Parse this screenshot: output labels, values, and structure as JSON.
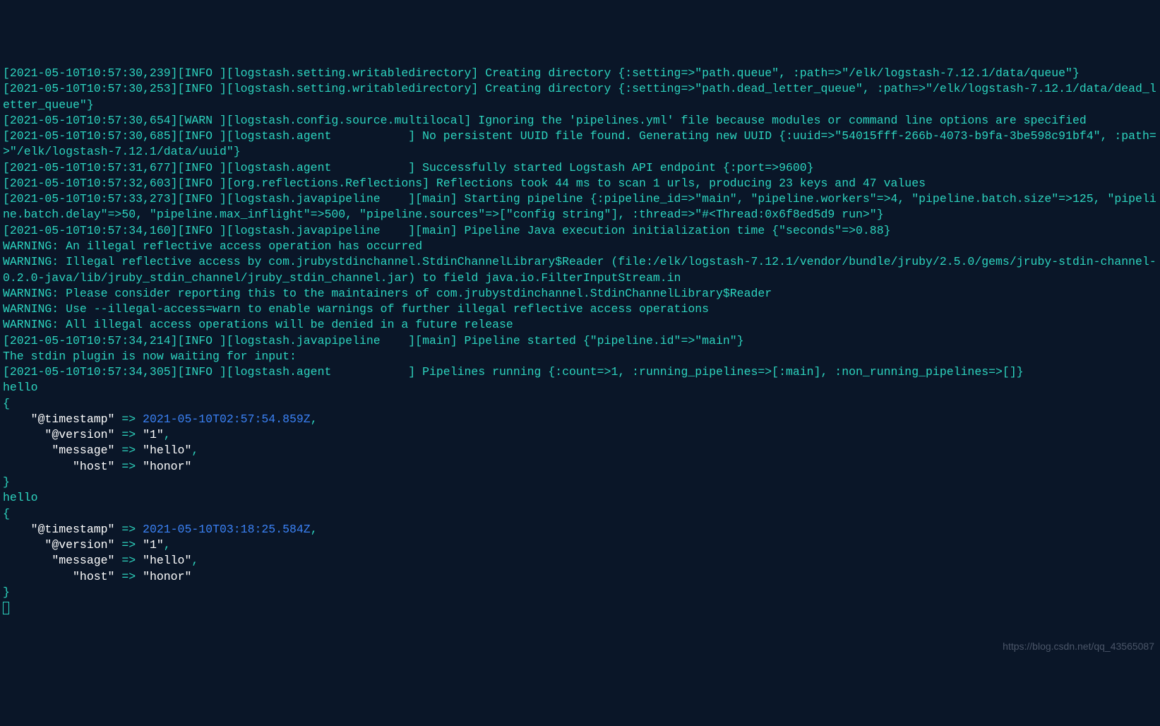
{
  "lines": [
    "[2021-05-10T10:57:30,239][INFO ][logstash.setting.writabledirectory] Creating directory {:setting=>\"path.queue\", :path=>\"/elk/logstash-7.12.1/data/queue\"}",
    "[2021-05-10T10:57:30,253][INFO ][logstash.setting.writabledirectory] Creating directory {:setting=>\"path.dead_letter_queue\", :path=>\"/elk/logstash-7.12.1/data/dead_letter_queue\"}",
    "[2021-05-10T10:57:30,654][WARN ][logstash.config.source.multilocal] Ignoring the 'pipelines.yml' file because modules or command line options are specified",
    "[2021-05-10T10:57:30,685][INFO ][logstash.agent           ] No persistent UUID file found. Generating new UUID {:uuid=>\"54015fff-266b-4073-b9fa-3be598c91bf4\", :path=>\"/elk/logstash-7.12.1/data/uuid\"}",
    "[2021-05-10T10:57:31,677][INFO ][logstash.agent           ] Successfully started Logstash API endpoint {:port=>9600}",
    "[2021-05-10T10:57:32,603][INFO ][org.reflections.Reflections] Reflections took 44 ms to scan 1 urls, producing 23 keys and 47 values",
    "[2021-05-10T10:57:33,273][INFO ][logstash.javapipeline    ][main] Starting pipeline {:pipeline_id=>\"main\", \"pipeline.workers\"=>4, \"pipeline.batch.size\"=>125, \"pipeline.batch.delay\"=>50, \"pipeline.max_inflight\"=>500, \"pipeline.sources\"=>[\"config string\"], :thread=>\"#<Thread:0x6f8ed5d9 run>\"}",
    "[2021-05-10T10:57:34,160][INFO ][logstash.javapipeline    ][main] Pipeline Java execution initialization time {\"seconds\"=>0.88}",
    "WARNING: An illegal reflective access operation has occurred",
    "WARNING: Illegal reflective access by com.jrubystdinchannel.StdinChannelLibrary$Reader (file:/elk/logstash-7.12.1/vendor/bundle/jruby/2.5.0/gems/jruby-stdin-channel-0.2.0-java/lib/jruby_stdin_channel/jruby_stdin_channel.jar) to field java.io.FilterInputStream.in",
    "WARNING: Please consider reporting this to the maintainers of com.jrubystdinchannel.StdinChannelLibrary$Reader",
    "WARNING: Use --illegal-access=warn to enable warnings of further illegal reflective access operations",
    "WARNING: All illegal access operations will be denied in a future release",
    "[2021-05-10T10:57:34,214][INFO ][logstash.javapipeline    ][main] Pipeline started {\"pipeline.id\"=>\"main\"}",
    "The stdin plugin is now waiting for input:",
    "[2021-05-10T10:57:34,305][INFO ][logstash.agent           ] Pipelines running {:count=>1, :running_pipelines=>[:main], :non_running_pipelines=>[]}"
  ],
  "input1": "hello",
  "obj1": {
    "timestamp_key": "\"@timestamp\"",
    "timestamp_val": "2021-05-10T02:57:54.859Z",
    "version_key": "\"@version\"",
    "version_val": "\"1\"",
    "message_key": "\"message\"",
    "message_val": "\"hello\"",
    "host_key": "\"host\"",
    "host_val": "\"honor\""
  },
  "input2": "hello",
  "obj2": {
    "timestamp_key": "\"@timestamp\"",
    "timestamp_val": "2021-05-10T03:18:25.584Z",
    "version_key": "\"@version\"",
    "version_val": "\"1\"",
    "message_key": "\"message\"",
    "message_val": "\"hello\"",
    "host_key": "\"host\"",
    "host_val": "\"honor\""
  },
  "watermark": "https://blog.csdn.net/qq_43565087",
  "arrow": " => ",
  "comma": ",",
  "open_brace": "{",
  "close_brace": "}"
}
